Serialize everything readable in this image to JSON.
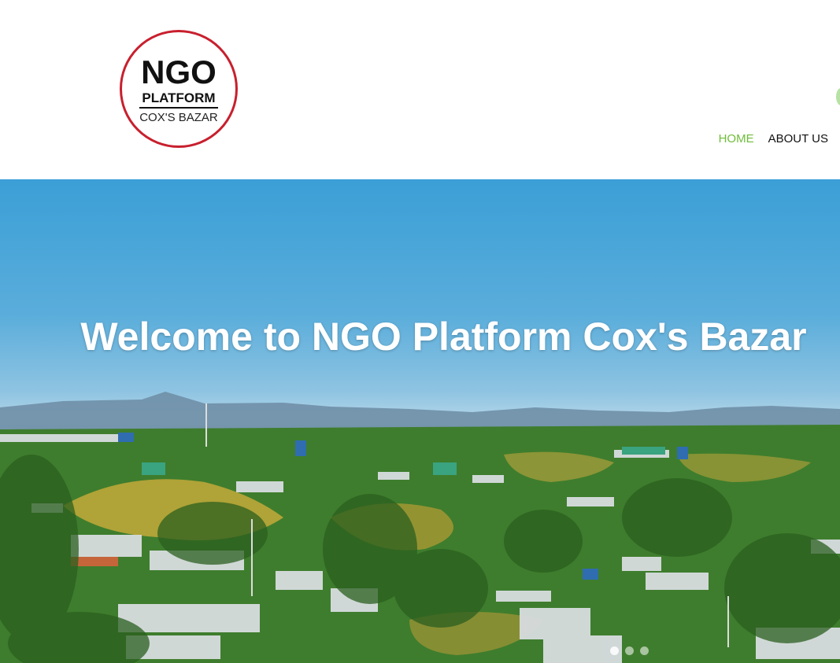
{
  "logo": {
    "line1": "NGO",
    "line2": "PLATFORM",
    "line3": "COX'S BAZAR"
  },
  "nav": {
    "items": [
      {
        "label": "HOME",
        "active": true
      },
      {
        "label": "ABOUT US",
        "active": false
      }
    ]
  },
  "hero": {
    "title": "Welcome to NGO Platform Cox's Bazar",
    "slider": {
      "count": 3,
      "active_index": 0
    }
  },
  "colors": {
    "accent_green": "#6fbd3a",
    "logo_ring": "#c8202e",
    "nav_text": "#111111"
  }
}
